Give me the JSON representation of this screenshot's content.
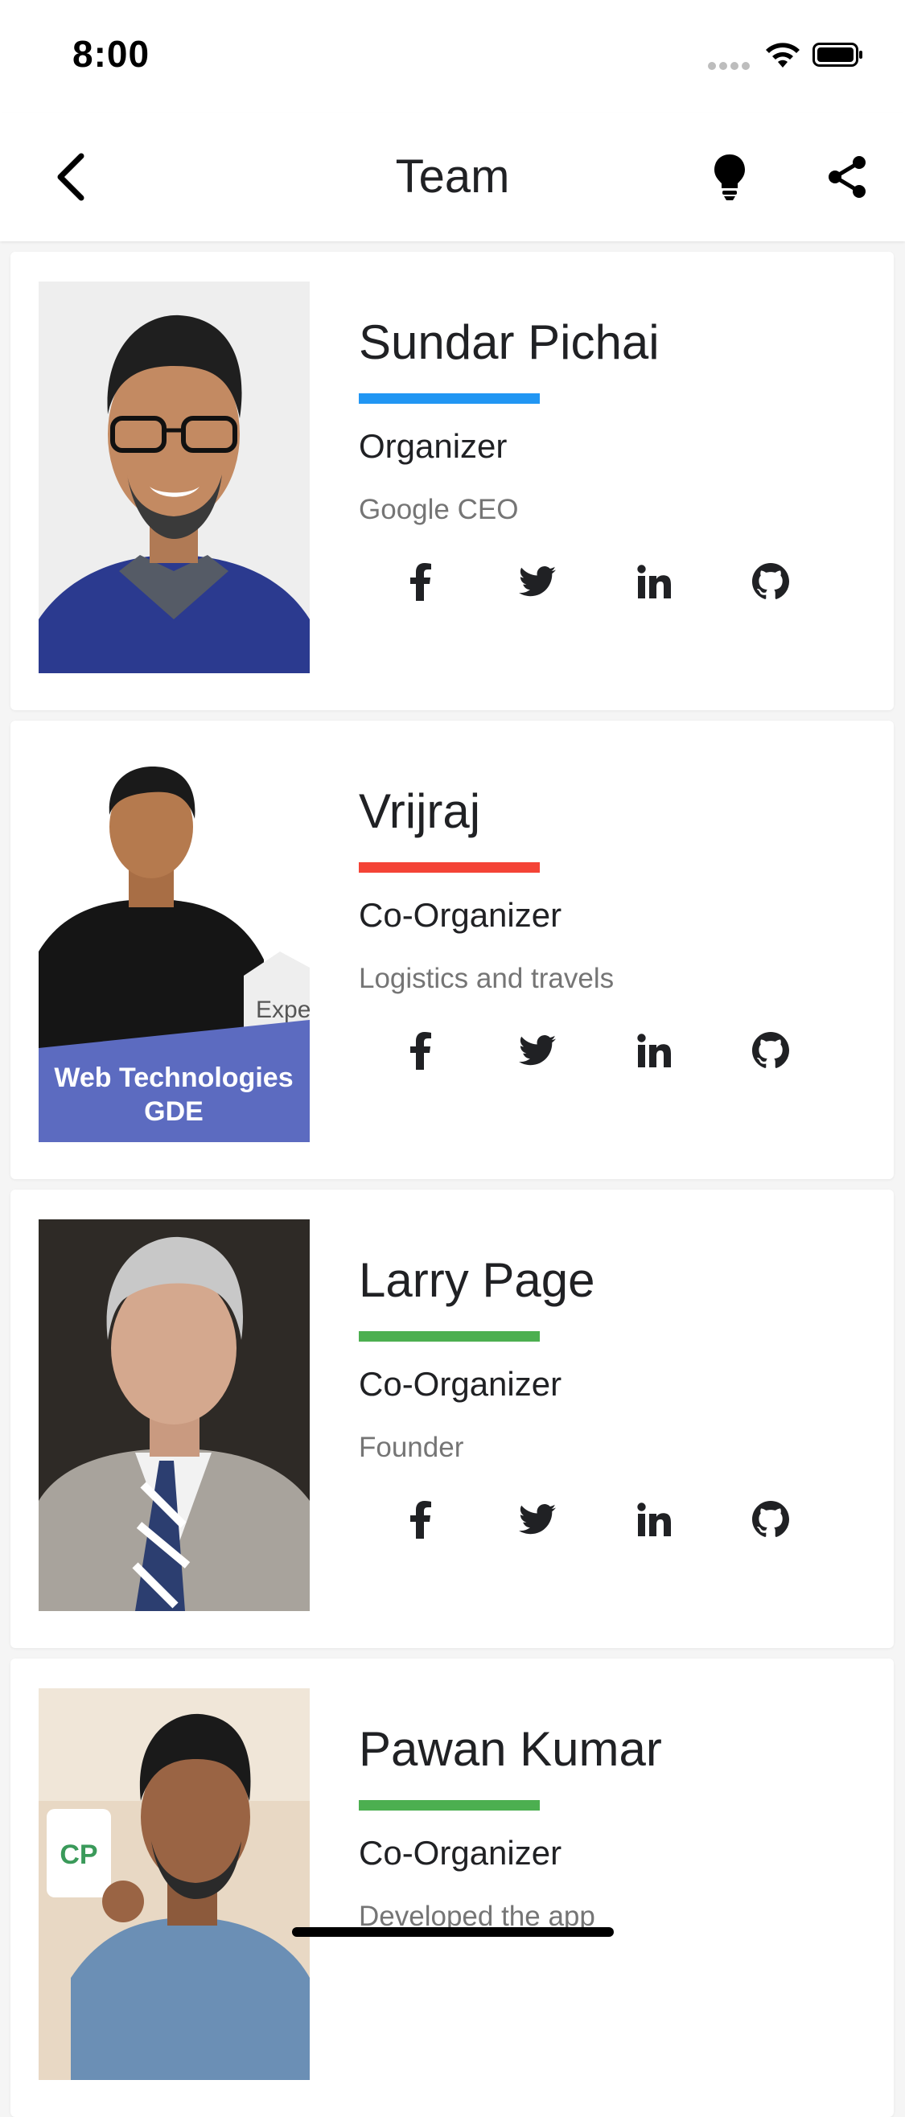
{
  "status_bar": {
    "time": "8:00"
  },
  "app_bar": {
    "title": "Team",
    "back_icon": "chevron-left-icon",
    "theme_icon": "lightbulb-icon",
    "share_icon": "share-icon"
  },
  "members": [
    {
      "name": "Sundar Pichai",
      "role": "Organizer",
      "description": "Google CEO",
      "accent": "#2196F3"
    },
    {
      "name": "Vrijraj",
      "role": "Co-Organizer",
      "description": "Logistics and travels",
      "accent": "#F44336",
      "photo_banner_line1": "Web Technologies",
      "photo_banner_line2": "GDE",
      "photo_badge": "Expe"
    },
    {
      "name": "Larry Page",
      "role": "Co-Organizer",
      "description": "Founder",
      "accent": "#4CAF50"
    },
    {
      "name": "Pawan Kumar",
      "role": "Co-Organizer",
      "description": "Developed the app",
      "accent": "#4CAF50"
    }
  ],
  "social_icons": [
    "facebook-icon",
    "twitter-icon",
    "linkedin-icon",
    "github-icon"
  ],
  "colors": {
    "background": "#F5F5F5",
    "card": "#FFFFFF",
    "text_primary": "#202124",
    "text_secondary": "#757575"
  }
}
